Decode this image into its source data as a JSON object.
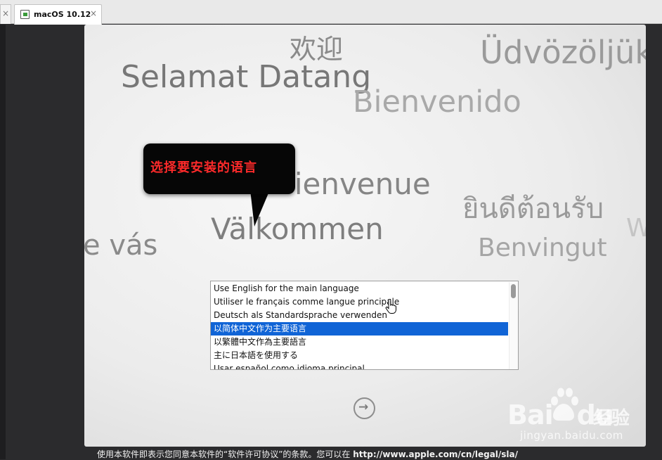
{
  "tabs": [
    {
      "label": "",
      "close_glyph": "×"
    },
    {
      "label": "macOS 10.12",
      "close_glyph": "×"
    }
  ],
  "welcome_words": [
    {
      "text": "欢迎",
      "color": "#8a8a8a"
    },
    {
      "text": "Selamat Datang",
      "color": "#777777"
    },
    {
      "text": "Üdvözöljük",
      "color": "#9a9a9a"
    },
    {
      "text": "Bienvenido",
      "color": "#a9a9a9"
    },
    {
      "text": "Bienvenue",
      "color": "#858585"
    },
    {
      "text": "ยินดีต้อนรับ",
      "color": "#9a9a9a"
    },
    {
      "text": "Välkommen",
      "color": "#7e7e7e"
    },
    {
      "text": "e vás",
      "color": "#8a8a8a"
    },
    {
      "text": "Benvingut",
      "color": "#a5a5a5"
    },
    {
      "text": "W",
      "color": "#c4c4c4"
    }
  ],
  "callout": {
    "text": "选择要安装的语言",
    "color": "#ff2a2a"
  },
  "language_list": {
    "items": [
      "Use English for the main language",
      "Utiliser le français comme langue principale",
      "Deutsch als Standardsprache verwenden",
      "以简体中文作为主要语言",
      "以繁體中文作為主要語言",
      "主に日本語を使用する",
      "Usar español como idioma principal"
    ],
    "selected_index": 3,
    "selection_color": "#1064d6"
  },
  "next_button": {
    "glyph": "→"
  },
  "license": {
    "text": "使用本软件即表示您同意本软件的“软件许可协议”的条款。您可以在 ",
    "url": "http://www.apple.com/cn/legal/sla/"
  },
  "watermark": {
    "brand_left": "Bai",
    "brand_right": "du",
    "product": "经验",
    "domain": "jingyan.baidu.com"
  }
}
